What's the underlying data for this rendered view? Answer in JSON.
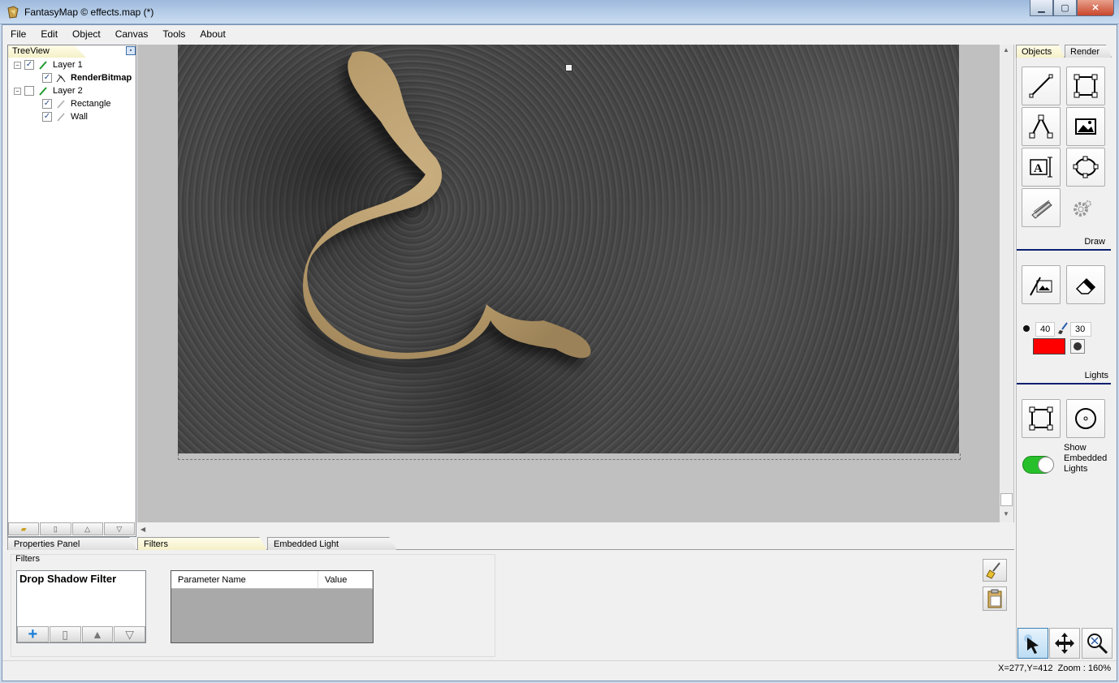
{
  "window": {
    "title": "FantasyMap © effects.map (*)",
    "btn_min": "▁",
    "btn_max": "▢",
    "btn_close": "✕"
  },
  "menu": [
    "File",
    "Edit",
    "Object",
    "Canvas",
    "Tools",
    "About"
  ],
  "tree": {
    "tab": "TreeView",
    "items": [
      {
        "label": "Layer 1",
        "checked": true,
        "expanded": true
      },
      {
        "label": "RenderBitmap",
        "checked": true,
        "bold": true
      },
      {
        "label": "Layer 2",
        "checked": false,
        "expanded": true
      },
      {
        "label": "Rectangle",
        "checked": true
      },
      {
        "label": "Wall",
        "checked": true
      }
    ]
  },
  "bottom_tabs": [
    "Properties Panel",
    "Filters",
    "Embedded Light"
  ],
  "filters": {
    "group_label": "Filters",
    "items": [
      "Drop Shadow Filter"
    ],
    "param_headers": [
      "Parameter Name",
      "Value"
    ]
  },
  "right": {
    "tabs": [
      "Objects",
      "Render"
    ],
    "draw_label": "Draw",
    "lights_label": "Lights",
    "brush_size": "40",
    "brush_hardness": "30",
    "light_color": "#ff0000",
    "show_embedded_lights": "Show Embedded Lights",
    "toggle_on": true
  },
  "status": {
    "text": "X=277,Y=412  Zoom : 160%"
  },
  "icons": [
    "app-icon",
    "pen-icon",
    "bitmap-icon",
    "line-tool-icon",
    "rect-tool-icon",
    "polygon-tool-icon",
    "image-tool-icon",
    "text-tool-icon",
    "ellipse-tool-icon",
    "wall-tool-icon",
    "gear-icon",
    "paint-bitmap-icon",
    "eraser-icon",
    "light-rect-icon",
    "light-circle-icon",
    "pointer-icon",
    "move-icon",
    "zoom-icon",
    "brush-icon",
    "paste-icon",
    "add-icon",
    "delete-icon",
    "up-icon",
    "down-icon"
  ]
}
